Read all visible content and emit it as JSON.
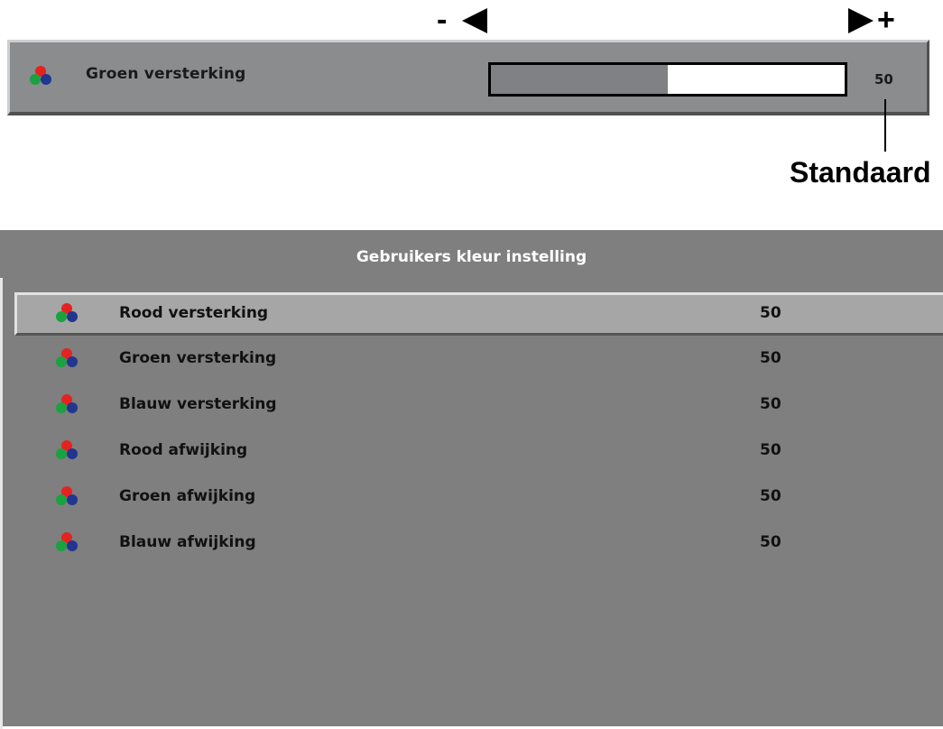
{
  "adjust_hint": {
    "minus": "-",
    "plus": "+"
  },
  "single_control": {
    "label": "Groen versterking",
    "value": "50",
    "slider_level": 0.5,
    "icon": "rgb-circles-icon"
  },
  "annotation": {
    "default_label": "Standaard"
  },
  "menu": {
    "title": "Gebruikers kleur instelling",
    "items": [
      {
        "label": "Rood versterking",
        "value": "50",
        "icon": "rgb-circles-icon"
      },
      {
        "label": "Groen versterking",
        "value": "50",
        "icon": "rgb-circles-icon"
      },
      {
        "label": "Blauw versterking",
        "value": "50",
        "icon": "rgb-circles-icon"
      },
      {
        "label": "Rood afwijking",
        "value": "50",
        "icon": "rgb-circles-icon"
      },
      {
        "label": "Groen afwijking",
        "value": "50",
        "icon": "rgb-circles-icon"
      },
      {
        "label": "Blauw afwijking",
        "value": "50",
        "icon": "rgb-circles-icon"
      }
    ],
    "selected_index": 0
  },
  "colors": {
    "icon_red": "#e42320",
    "icon_green": "#19a23f",
    "icon_blue": "#22358f",
    "menu_bg": "#7f7f7f",
    "selected_row_bg": "#a6a6a6"
  }
}
